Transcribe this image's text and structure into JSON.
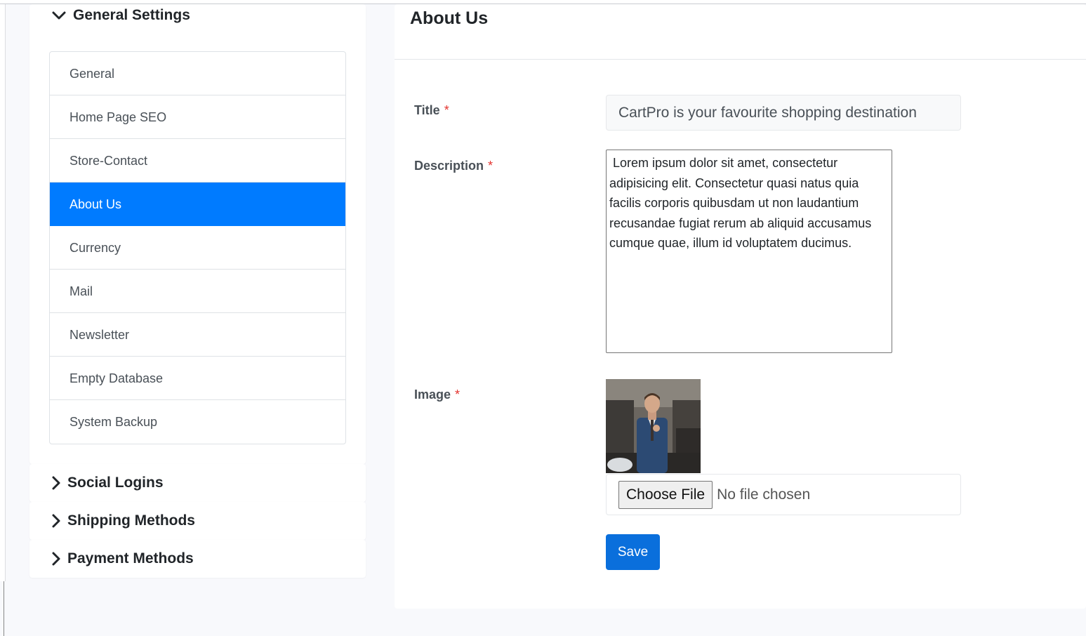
{
  "sidebar": {
    "general_settings": {
      "heading": "General Settings",
      "items": [
        {
          "label": "General",
          "active": false
        },
        {
          "label": "Home Page SEO",
          "active": false
        },
        {
          "label": "Store-Contact",
          "active": false
        },
        {
          "label": "About Us",
          "active": true
        },
        {
          "label": "Currency",
          "active": false
        },
        {
          "label": "Mail",
          "active": false
        },
        {
          "label": "Newsletter",
          "active": false
        },
        {
          "label": "Empty Database",
          "active": false
        },
        {
          "label": "System Backup",
          "active": false
        }
      ]
    },
    "social_logins": {
      "heading": "Social Logins"
    },
    "shipping_methods": {
      "heading": "Shipping Methods"
    },
    "payment_methods": {
      "heading": "Payment Methods"
    }
  },
  "main": {
    "title": "About Us",
    "form": {
      "title_label": "Title",
      "title_value": "CartPro is your favourite shopping destination",
      "description_label": "Description",
      "description_value": " Lorem ipsum dolor sit amet, consectetur adipisicing elit. Consectetur quasi natus quia facilis corporis quibusdam ut non laudantium recusandae fugiat rerum ab aliquid accusamus cumque quae, illum id voluptatem ducimus.",
      "image_label": "Image",
      "required_mark": "*",
      "choose_file_label": "Choose File",
      "file_status": "No file chosen",
      "save_label": "Save"
    }
  },
  "colors": {
    "accent": "#007bff",
    "save_button": "#0a6fdc",
    "required": "#e3342f"
  }
}
